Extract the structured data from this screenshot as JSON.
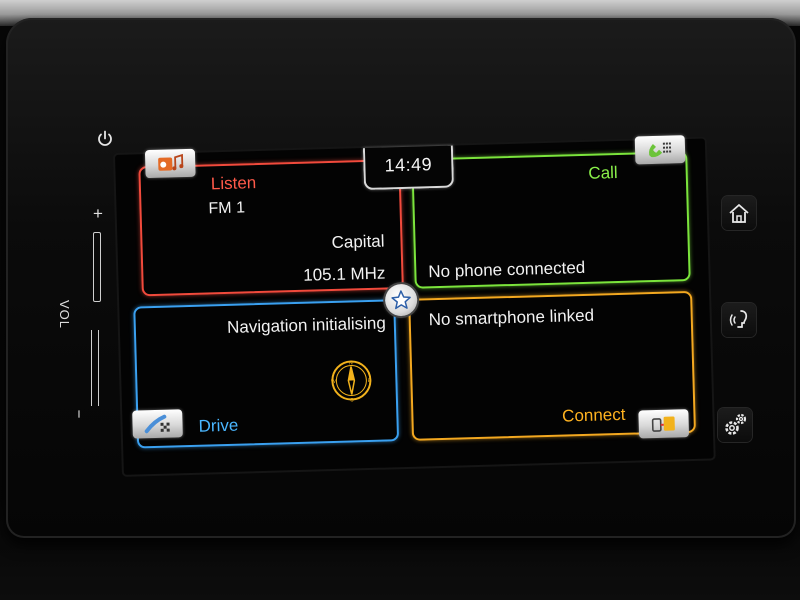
{
  "clock": {
    "time": "14:49"
  },
  "tiles": {
    "listen": {
      "title": "Listen",
      "band": "FM 1",
      "station": "Capital",
      "frequency": "105.1 MHz",
      "color": "#f14a3c"
    },
    "call": {
      "title": "Call",
      "status": "No phone connected",
      "color": "#7be43c"
    },
    "drive": {
      "title": "Drive",
      "status": "Navigation initialising",
      "color": "#3aa0f0"
    },
    "connect": {
      "title": "Connect",
      "status": "No smartphone linked",
      "color": "#f3a820"
    }
  },
  "hardware": {
    "volume_label": "VOL",
    "volume_plus": "+",
    "volume_minus": "−"
  },
  "icons": {
    "power": "power-icon",
    "home": "home-icon",
    "voice": "voice-icon",
    "settings": "gear-icon",
    "favorite": "star-icon",
    "compass": "compass-icon"
  }
}
